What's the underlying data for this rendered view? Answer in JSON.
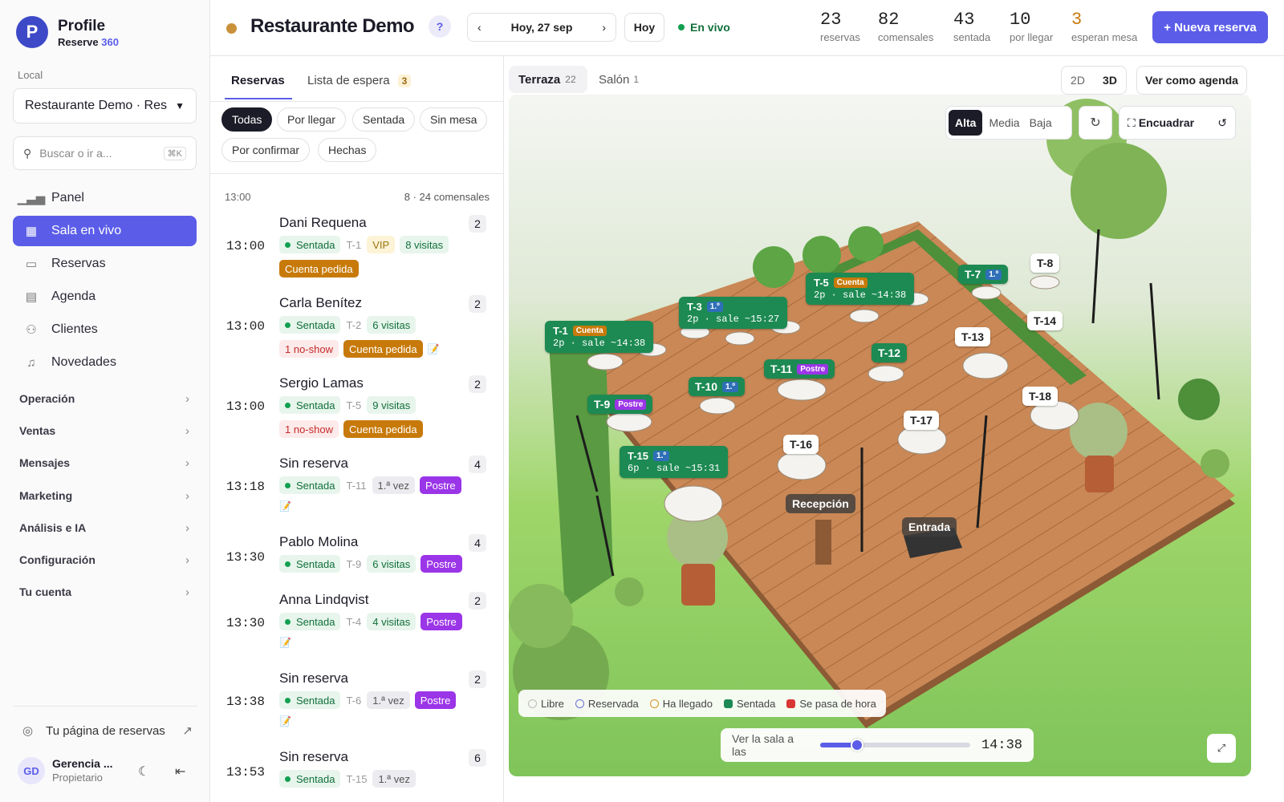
{
  "brand": {
    "title": "Profile",
    "product": "Reserve",
    "product_num": "360",
    "logo_letter": "P"
  },
  "sidebar": {
    "local_label": "Local",
    "local_value": "Restaurante Demo · Res",
    "search_placeholder": "Buscar o ir a...",
    "search_shortcut": "⌘K",
    "items": [
      {
        "label": "Panel",
        "icon": "chart-icon"
      },
      {
        "label": "Sala en vivo",
        "icon": "grid-icon",
        "active": true
      },
      {
        "label": "Reservas",
        "icon": "calendar-icon"
      },
      {
        "label": "Agenda",
        "icon": "table-icon"
      },
      {
        "label": "Clientes",
        "icon": "users-icon"
      },
      {
        "label": "Novedades",
        "icon": "bell-icon"
      }
    ],
    "groups": [
      "Operación",
      "Ventas",
      "Mensajes",
      "Marketing",
      "Análisis e IA",
      "Configuración",
      "Tu cuenta"
    ],
    "booking_page": "Tu página de reservas",
    "user": {
      "initials": "GD",
      "name": "Gerencia ...",
      "role": "Propietario"
    }
  },
  "header": {
    "restaurant": "Restaurante Demo",
    "help": "?",
    "date": "Hoy, 27 sep",
    "today": "Hoy",
    "live": "En vivo",
    "stats": [
      {
        "n": "23",
        "l": "reservas"
      },
      {
        "n": "82",
        "l": "comensales"
      },
      {
        "n": "43",
        "l": "sentada"
      },
      {
        "n": "10",
        "l": "por llegar"
      },
      {
        "n": "3",
        "l": "esperan mesa"
      }
    ],
    "new_button": "+ Nueva reserva"
  },
  "list": {
    "tabs": [
      {
        "label": "Reservas"
      },
      {
        "label": "Lista de espera",
        "count": "3"
      }
    ],
    "filters": [
      "Todas",
      "Por llegar",
      "Sentada",
      "Sin mesa",
      "Por confirmar",
      "Hechas"
    ],
    "slot": {
      "time": "13:00",
      "summary": "8 · 24 comensales"
    },
    "reservations": [
      {
        "time": "13:00",
        "name": "Dani Requena",
        "count": "2",
        "status": "Sentada",
        "table": "T-1",
        "tags": [
          [
            "vip",
            "VIP"
          ],
          [
            "vis",
            "8 visitas"
          ]
        ],
        "tags2": [
          [
            "bill",
            "Cuenta pedida"
          ]
        ]
      },
      {
        "time": "13:00",
        "name": "Carla Benítez",
        "count": "2",
        "status": "Sentada",
        "table": "T-2",
        "tags": [
          [
            "vis",
            "6 visitas"
          ]
        ],
        "tags2": [
          [
            "noshow",
            "1 no-show"
          ],
          [
            "bill",
            "Cuenta pedida"
          ],
          [
            "note",
            "📝"
          ]
        ]
      },
      {
        "time": "13:00",
        "name": "Sergio Lamas",
        "count": "2",
        "status": "Sentada",
        "table": "T-5",
        "tags": [
          [
            "vis",
            "9 visitas"
          ]
        ],
        "tags2": [
          [
            "noshow",
            "1 no-show"
          ],
          [
            "bill",
            "Cuenta pedida"
          ]
        ]
      },
      {
        "time": "13:18",
        "name": "Sin reserva",
        "count": "4",
        "status": "Sentada",
        "table": "T-11",
        "tags": [
          [
            "first",
            "1.ª vez"
          ],
          [
            "post",
            "Postre"
          ]
        ],
        "tags2": [
          [
            "note",
            "📝"
          ]
        ]
      },
      {
        "time": "13:30",
        "name": "Pablo Molina",
        "count": "4",
        "status": "Sentada",
        "table": "T-9",
        "tags": [
          [
            "vis",
            "6 visitas"
          ],
          [
            "post",
            "Postre"
          ]
        ],
        "tags2": []
      },
      {
        "time": "13:30",
        "name": "Anna Lindqvist",
        "count": "2",
        "status": "Sentada",
        "table": "T-4",
        "tags": [
          [
            "vis",
            "4 visitas"
          ],
          [
            "post",
            "Postre"
          ]
        ],
        "tags2": [
          [
            "note",
            "📝"
          ]
        ]
      },
      {
        "time": "13:38",
        "name": "Sin reserva",
        "count": "2",
        "status": "Sentada",
        "table": "T-6",
        "tags": [
          [
            "first",
            "1.ª vez"
          ],
          [
            "post",
            "Postre"
          ]
        ],
        "tags2": [
          [
            "note",
            "📝"
          ]
        ]
      },
      {
        "time": "13:53",
        "name": "Sin reserva",
        "count": "6",
        "status": "Sentada",
        "table": "T-15",
        "tags": [
          [
            "first",
            "1.ª vez"
          ]
        ],
        "tags2": []
      }
    ]
  },
  "map": {
    "rooms": [
      {
        "label": "Terraza",
        "count": "22"
      },
      {
        "label": "Salón",
        "count": "1"
      }
    ],
    "view_2d": "2D",
    "view_3d": "3D",
    "agenda": "Ver como agenda",
    "quality": [
      "Alta",
      "Media",
      "Baja"
    ],
    "frame": "Encuadrar",
    "tables": [
      {
        "id": "T-1",
        "badge": "Cuenta",
        "badge_type": "bill",
        "sub": "2p · sale ~14:38"
      },
      {
        "id": "T-3",
        "badge": "1.º",
        "badge_type": "first",
        "sub": "2p · sale ~15:27"
      },
      {
        "id": "T-5",
        "badge": "Cuenta",
        "badge_type": "bill",
        "sub": "2p · sale ~14:38"
      },
      {
        "id": "T-7",
        "badge": "1.º",
        "badge_type": "first"
      },
      {
        "id": "T-8"
      },
      {
        "id": "T-9",
        "badge": "Postre",
        "badge_type": "post"
      },
      {
        "id": "T-10",
        "badge": "1.º",
        "badge_type": "first"
      },
      {
        "id": "T-11",
        "badge": "Postre",
        "badge_type": "post"
      },
      {
        "id": "T-12"
      },
      {
        "id": "T-13"
      },
      {
        "id": "T-14"
      },
      {
        "id": "T-15",
        "badge": "1.º",
        "badge_type": "first",
        "sub": "6p · sale ~15:31"
      },
      {
        "id": "T-16"
      },
      {
        "id": "T-17"
      },
      {
        "id": "T-18"
      }
    ],
    "places": [
      "Recepción",
      "Entrada"
    ],
    "legend": [
      "Libre",
      "Reservada",
      "Ha llegado",
      "Sentada",
      "Se pasa de hora"
    ],
    "legend_colors": [
      "#ffffff",
      "#ffffff",
      "#ffffff",
      "#1d8a53",
      "#d93636"
    ],
    "slider_label": "Ver la sala a las",
    "slider_time": "14:38",
    "slider_fraction": 0.25
  }
}
